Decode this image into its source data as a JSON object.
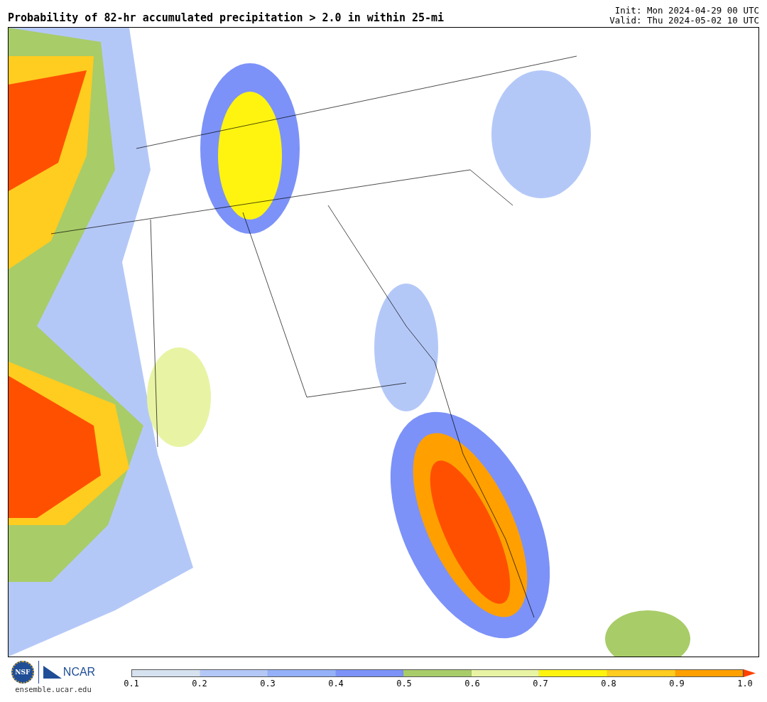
{
  "title": "Probability of 82-hr accumulated precipitation > 2.0 in within 25-mi",
  "init": "Init: Mon 2024-04-29 00 UTC",
  "valid": "Valid: Thu 2024-05-02 10 UTC",
  "logos": {
    "nsf": "NSF",
    "ncar": "NCAR",
    "site": "ensemble.ucar.edu"
  },
  "colorbar": {
    "bins": [
      {
        "color": "#d6e2ef"
      },
      {
        "color": "#b4c8f8"
      },
      {
        "color": "#94b0f8"
      },
      {
        "color": "#7c92f8"
      },
      {
        "color": "#a8cc68"
      },
      {
        "color": "#e8f4a4"
      },
      {
        "color": "#fff410"
      },
      {
        "color": "#ffcc20"
      },
      {
        "color": "#ffa000"
      }
    ],
    "arrow": {
      "color": "#ff4000"
    },
    "ticks": [
      "0.1",
      "0.2",
      "0.3",
      "0.4",
      "0.5",
      "0.6",
      "0.7",
      "0.8",
      "0.9",
      "1.0"
    ]
  }
}
